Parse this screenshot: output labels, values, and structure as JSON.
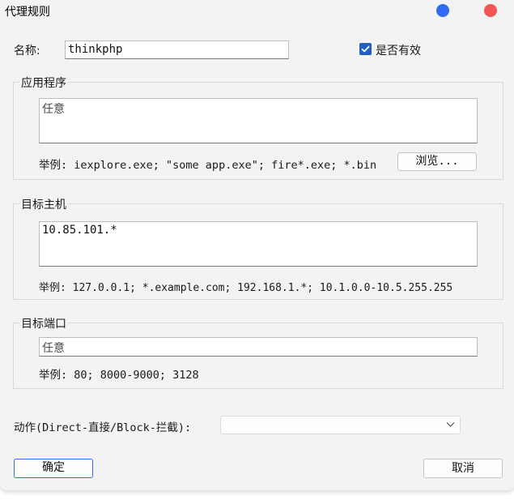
{
  "window": {
    "title": "代理规则"
  },
  "name_field": {
    "label": "名称:",
    "value": "thinkphp"
  },
  "enabled_checkbox": {
    "label": "是否有效",
    "checked": true
  },
  "applications": {
    "group_title": "应用程序",
    "value": "任意",
    "example": "举例: iexplore.exe; \"some app.exe\"; fire*.exe; *.bin",
    "browse_label": "浏览..."
  },
  "target_hosts": {
    "group_title": "目标主机",
    "value": "10.85.101.*",
    "example": "举例: 127.0.0.1; *.example.com; 192.168.1.*; 10.1.0.0-10.5.255.255"
  },
  "target_ports": {
    "group_title": "目标端口",
    "value": "任意",
    "example": "举例: 80; 8000-9000; 3128"
  },
  "action": {
    "label": "动作(Direct-直接/Block-拦截):",
    "selected": ""
  },
  "buttons": {
    "ok_label": "确定",
    "cancel_label": "取消"
  },
  "colors": {
    "accent": "#2f6cf3",
    "close_dot": "#f25757",
    "checkbox": "#1f5fbf"
  }
}
